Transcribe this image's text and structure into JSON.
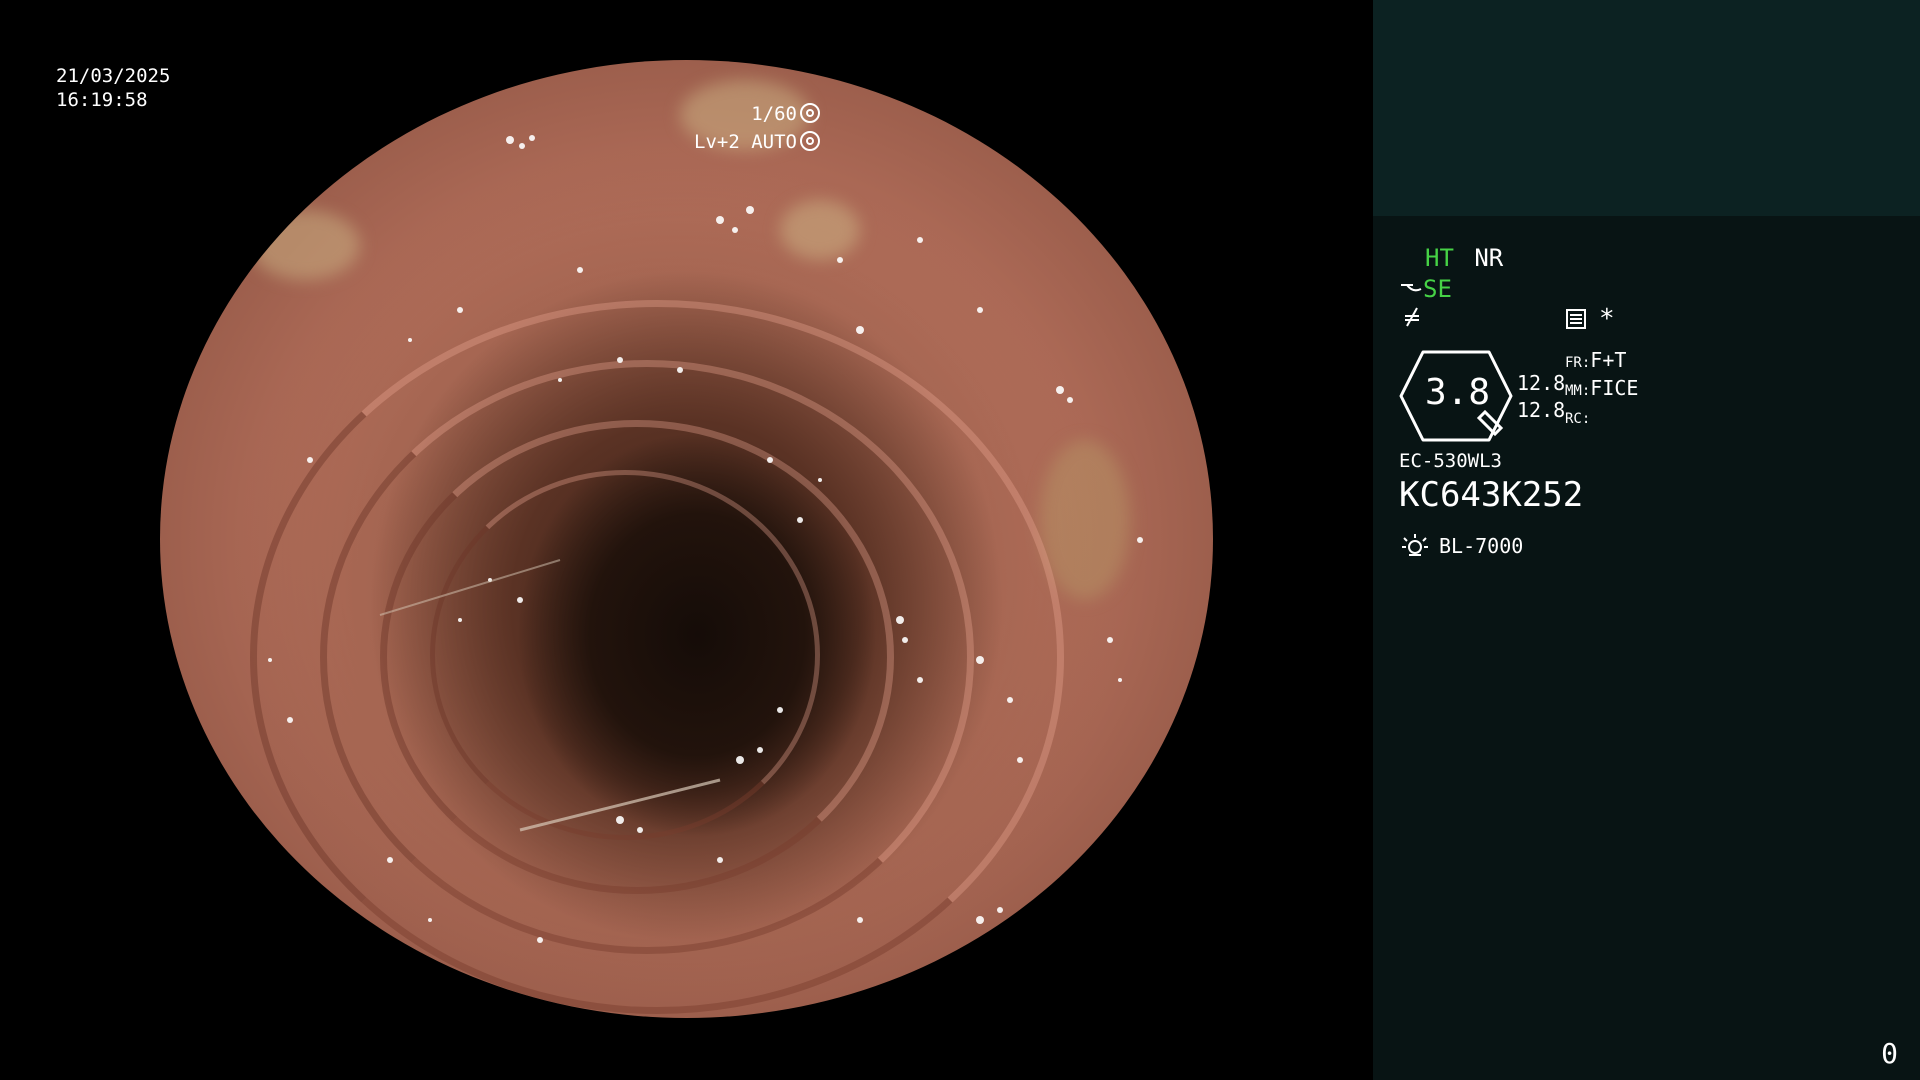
{
  "overlay": {
    "date": "21/03/2025",
    "time": "16:19:58",
    "shutter_speed": "1/60",
    "iris_mode": "Lv+2 AUTO"
  },
  "panel": {
    "ht": "HT",
    "nr": "NR",
    "se": "SE",
    "zoom_value": "3.8",
    "value_top": "12.8",
    "value_bottom": "12.8",
    "fr_label": "FR:",
    "fr_value": "F+T",
    "mm_label": "MM:",
    "mm_value": "FICE",
    "rc_label": "RC:",
    "asterisk": "*",
    "scope_model": "EC-530WL3",
    "serial_number": "KC643K252",
    "light_source": "BL-7000",
    "frame_counter": "0",
    "accent_color": "#46d246",
    "icons": [
      "enhancement-icon",
      "color-tone-icon",
      "settings-list-icon",
      "light-source-icon"
    ]
  }
}
